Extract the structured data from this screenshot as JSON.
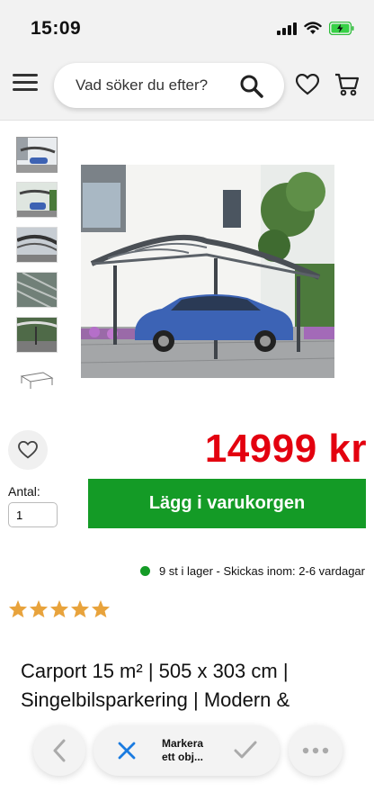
{
  "status_bar": {
    "time": "15:09"
  },
  "header": {
    "search_placeholder": "Vad söker du efter?"
  },
  "product": {
    "price": "14999 kr",
    "quantity_label": "Antal:",
    "quantity_value": "1",
    "add_to_cart_label": "Lägg i varukorgen",
    "stock_text": "9 st i lager - Skickas inom: 2-6 vardagar",
    "rating": 5,
    "title": "Carport 15 m² | 505 x 303 cm | Singelbilsparkering | Modern &"
  },
  "toolbar": {
    "select_label_line1": "Markera",
    "select_label_line2": "ett obj..."
  },
  "colors": {
    "price": "#e3000f",
    "add_button": "#149b26",
    "star": "#e8a33c",
    "stock_dot": "#149b26"
  },
  "icons": [
    "menu-icon",
    "search-icon",
    "heart-icon",
    "cart-icon",
    "back-icon",
    "close-icon",
    "check-icon",
    "more-icon"
  ]
}
